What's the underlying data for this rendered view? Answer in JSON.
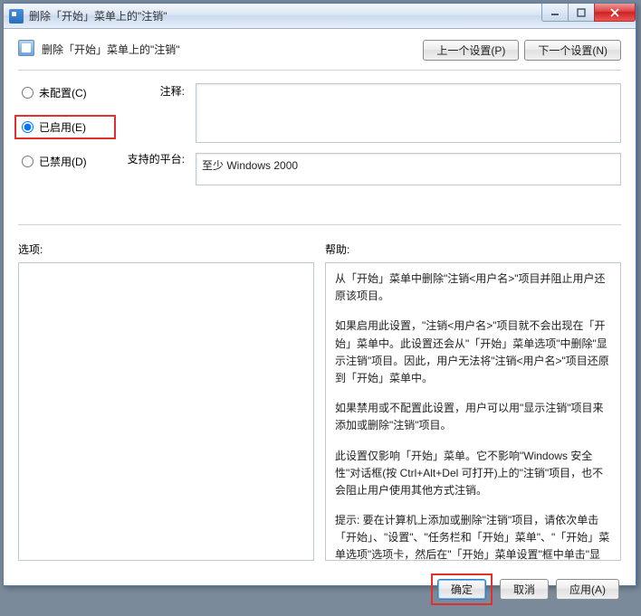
{
  "titlebar": {
    "text": "删除「开始」菜单上的\"注销\""
  },
  "header": {
    "title": "删除「开始」菜单上的\"注销\"",
    "prev_label": "上一个设置(P)",
    "next_label": "下一个设置(N)"
  },
  "radios": {
    "not_configured": "未配置(C)",
    "enabled": "已启用(E)",
    "disabled": "已禁用(D)"
  },
  "labels": {
    "comment": "注释:",
    "supported": "支持的平台:",
    "options": "选项:",
    "help": "帮助:"
  },
  "fields": {
    "comment_value": "",
    "supported_value": "至少 Windows 2000"
  },
  "help": {
    "p1": "从「开始」菜单中删除\"注销<用户名>\"项目并阻止用户还原该项目。",
    "p2": "如果启用此设置，\"注销<用户名>\"项目就不会出现在「开始」菜单中。此设置还会从\"「开始」菜单选项\"中删除\"显示注销\"项目。因此，用户无法将\"注销<用户名>\"项目还原到「开始」菜单中。",
    "p3": "如果禁用或不配置此设置，用户可以用\"显示注销\"项目来添加或删除\"注销\"项目。",
    "p4": "此设置仅影响「开始」菜单。它不影响\"Windows 安全性\"对话框(按 Ctrl+Alt+Del 可打开)上的\"注销\"项目，也不会阻止用户使用其他方式注销。",
    "p5": "提示: 要在计算机上添加或删除\"注销\"项目，请依次单击「开始」、\"设置\"、\"任务栏和「开始」菜单\"、\"「开始」菜单选项\"选项卡，然后在\"「开始」菜单设置\"框中单击\"显示注销\"。"
  },
  "footer": {
    "ok": "确定",
    "cancel": "取消",
    "apply": "应用(A)"
  },
  "state": {
    "selected_radio": "enabled"
  }
}
